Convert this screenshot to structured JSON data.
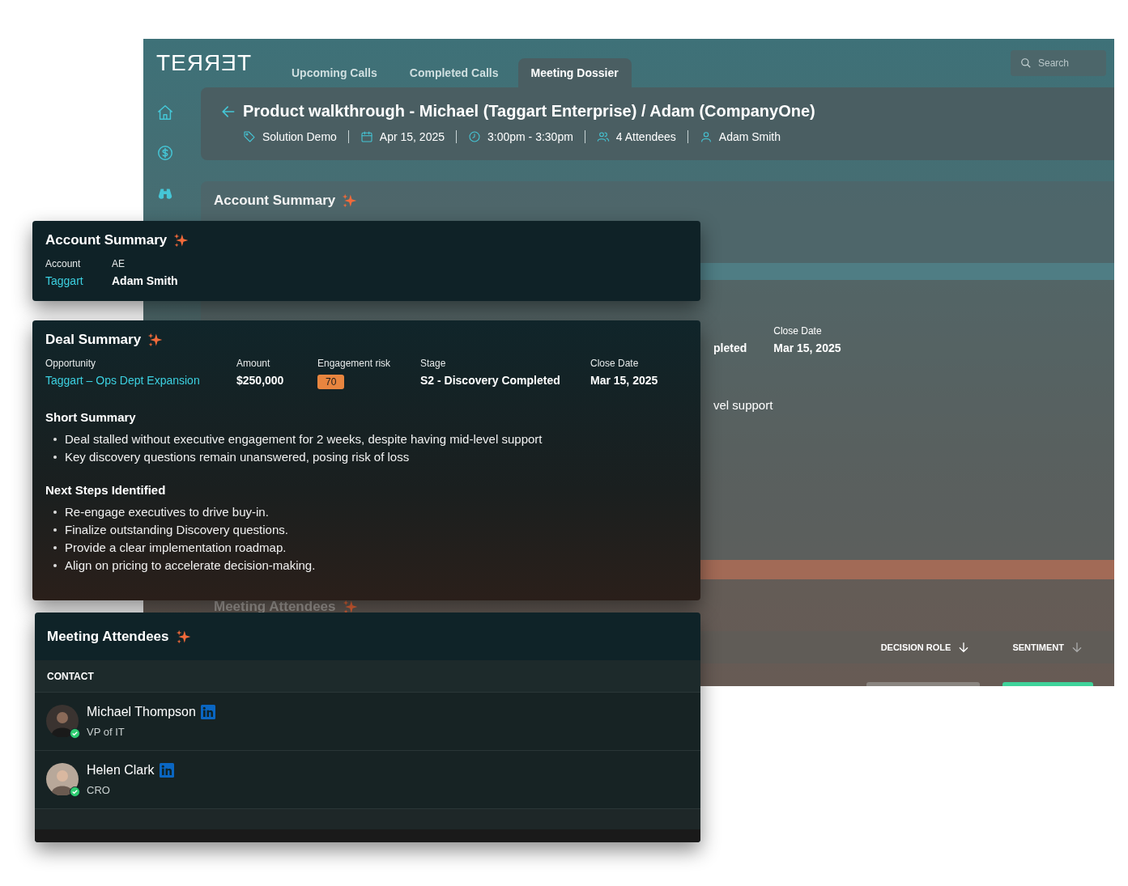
{
  "logo": "TEЯЯƎT",
  "tabs": [
    {
      "label": "Upcoming Calls",
      "selected": false
    },
    {
      "label": "Completed Calls",
      "selected": false
    },
    {
      "label": "Meeting Dossier",
      "selected": true
    }
  ],
  "search": {
    "placeholder": "Search"
  },
  "sidebar": {
    "items": [
      {
        "kind": "home"
      },
      {
        "kind": "dollar"
      },
      {
        "kind": "binoculars"
      }
    ]
  },
  "meeting": {
    "title": "Product walkthrough - Michael (Taggart Enterprise) / Adam (CompanyOne)",
    "meta": [
      {
        "kind": "tag",
        "text": "Solution Demo"
      },
      {
        "kind": "date",
        "text": "Apr 15, 2025"
      },
      {
        "kind": "time",
        "text": "3:00pm - 3:30pm"
      },
      {
        "kind": "people",
        "text": "4 Attendees"
      },
      {
        "kind": "person",
        "text": "Adam Smith"
      }
    ]
  },
  "background": {
    "account_title": "Account Summary",
    "stage_fragment": "pleted",
    "close_date_label": "Close Date",
    "close_date": "Mar 15, 2025",
    "summary_fragment": "vel support",
    "attendees_title": "Meeting Attendees",
    "columns": [
      {
        "label": "DECISION ROLE"
      },
      {
        "label": "SENTIMENT"
      }
    ]
  },
  "account_card": {
    "title": "Account Summary",
    "fields": [
      {
        "label": "Account",
        "value": "Taggart",
        "kind": "link"
      },
      {
        "label": "AE",
        "value": "Adam Smith",
        "kind": "text"
      }
    ]
  },
  "deal_card": {
    "title": "Deal Summary",
    "fields": [
      {
        "label": "Opportunity",
        "value": "Taggart – Ops Dept Expansion",
        "kind": "link"
      },
      {
        "label": "Amount",
        "value": "$250,000",
        "kind": "text"
      },
      {
        "label": "Engagement risk",
        "value": "70",
        "kind": "badge"
      },
      {
        "label": "Stage",
        "value": "S2 - Discovery Completed",
        "kind": "text"
      },
      {
        "label": "Close Date",
        "value": "Mar 15, 2025",
        "kind": "text"
      }
    ],
    "sections": [
      {
        "heading": "Short Summary",
        "bullets": [
          "Deal stalled without executive engagement for 2 weeks, despite having mid-level support",
          "Key discovery questions remain unanswered, posing risk of loss"
        ]
      },
      {
        "heading": "Next Steps Identified",
        "bullets": [
          "Re-engage executives to drive buy-in.",
          "Finalize outstanding Discovery questions.",
          "Provide a clear implementation roadmap.",
          "Align on pricing to accelerate decision-making."
        ]
      }
    ]
  },
  "attendees_card": {
    "title": "Meeting Attendees",
    "column": "CONTACT",
    "contacts": [
      {
        "name": "Michael Thompson",
        "role": "VP of IT",
        "verified": true
      },
      {
        "name": "Helen Clark",
        "role": "CRO",
        "verified": true
      }
    ]
  }
}
